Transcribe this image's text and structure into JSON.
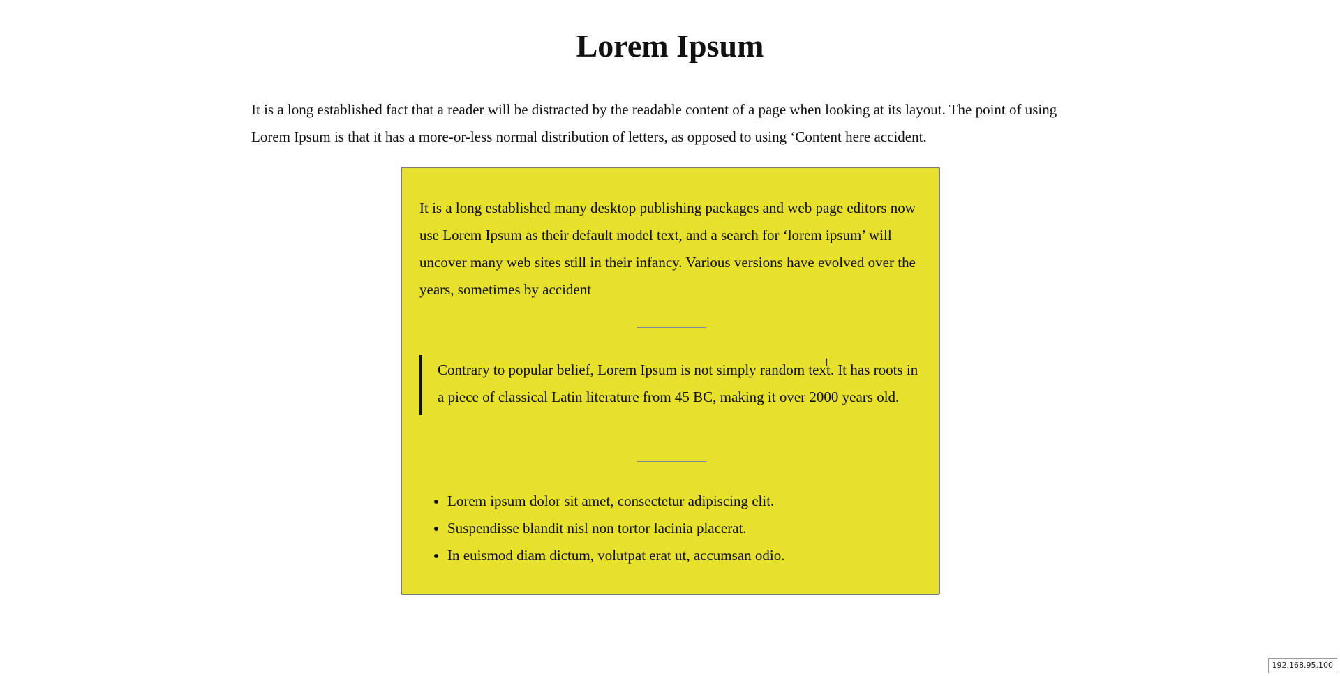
{
  "page": {
    "title": "Lorem Ipsum",
    "intro": "It is a long established fact that a reader will be distracted by the readable content of a page when looking at its layout. The point of using Lorem Ipsum is that it has a more-or-less normal distribution of letters, as opposed to using ‘Content here accident."
  },
  "card": {
    "paragraph": "It is a long established many desktop publishing packages and web page editors now use Lorem Ipsum as their default model text, and a search for ‘lorem ipsum’ will uncover many web sites still in their infancy. Various versions have evolved over the years, sometimes by accident",
    "quote": "Contrary to popular belief, Lorem Ipsum is not simply random text. It has roots in a piece of classical Latin literature from 45 BC, making it over 2000 years old.",
    "list": [
      "Lorem ipsum dolor sit amet, consectetur adipiscing elit.",
      "Suspendisse blandit nisl non tortor lacinia placerat.",
      "In euismod diam dictum, volutpat erat ut, accumsan odio."
    ]
  },
  "status": {
    "ip": "192.168.95.100"
  },
  "colors": {
    "card_background": "#e7e12e",
    "card_border": "#7a7a7a",
    "divider": "#7d8aa0",
    "quote_bar": "#111111"
  }
}
